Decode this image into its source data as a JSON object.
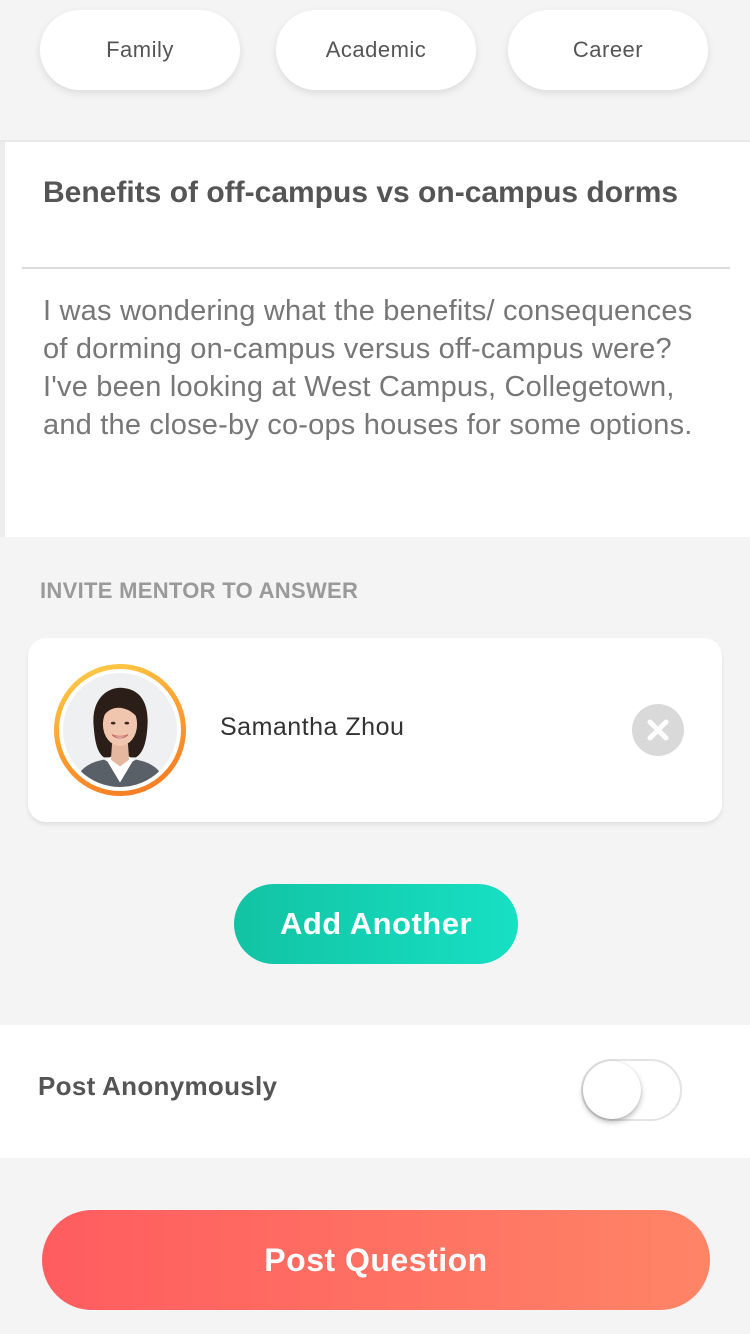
{
  "categories": [
    {
      "label": "Family"
    },
    {
      "label": "Academic"
    },
    {
      "label": "Career"
    }
  ],
  "question": {
    "title": "Benefits of off-campus vs on-campus dorms",
    "body": "I was wondering what the benefits/ consequences of dorming on-campus versus off-campus were? I've been looking at West Campus, Collegetown, and the close-by co-ops houses for some options."
  },
  "invite": {
    "section_label": "INVITE MENTOR TO ANSWER",
    "mentors": [
      {
        "name": "Samantha Zhou",
        "avatar_ring_colors": [
          "#ffd24a",
          "#f47421"
        ],
        "remove_icon": "close-circle-icon"
      }
    ],
    "add_label": "Add Another"
  },
  "anonymous": {
    "label": "Post Anonymously",
    "enabled": false
  },
  "post_button": {
    "label": "Post Question"
  },
  "colors": {
    "accent_teal": "#12c3a3",
    "accent_coral": "#ff5c5f",
    "background": "#f4f4f4"
  }
}
